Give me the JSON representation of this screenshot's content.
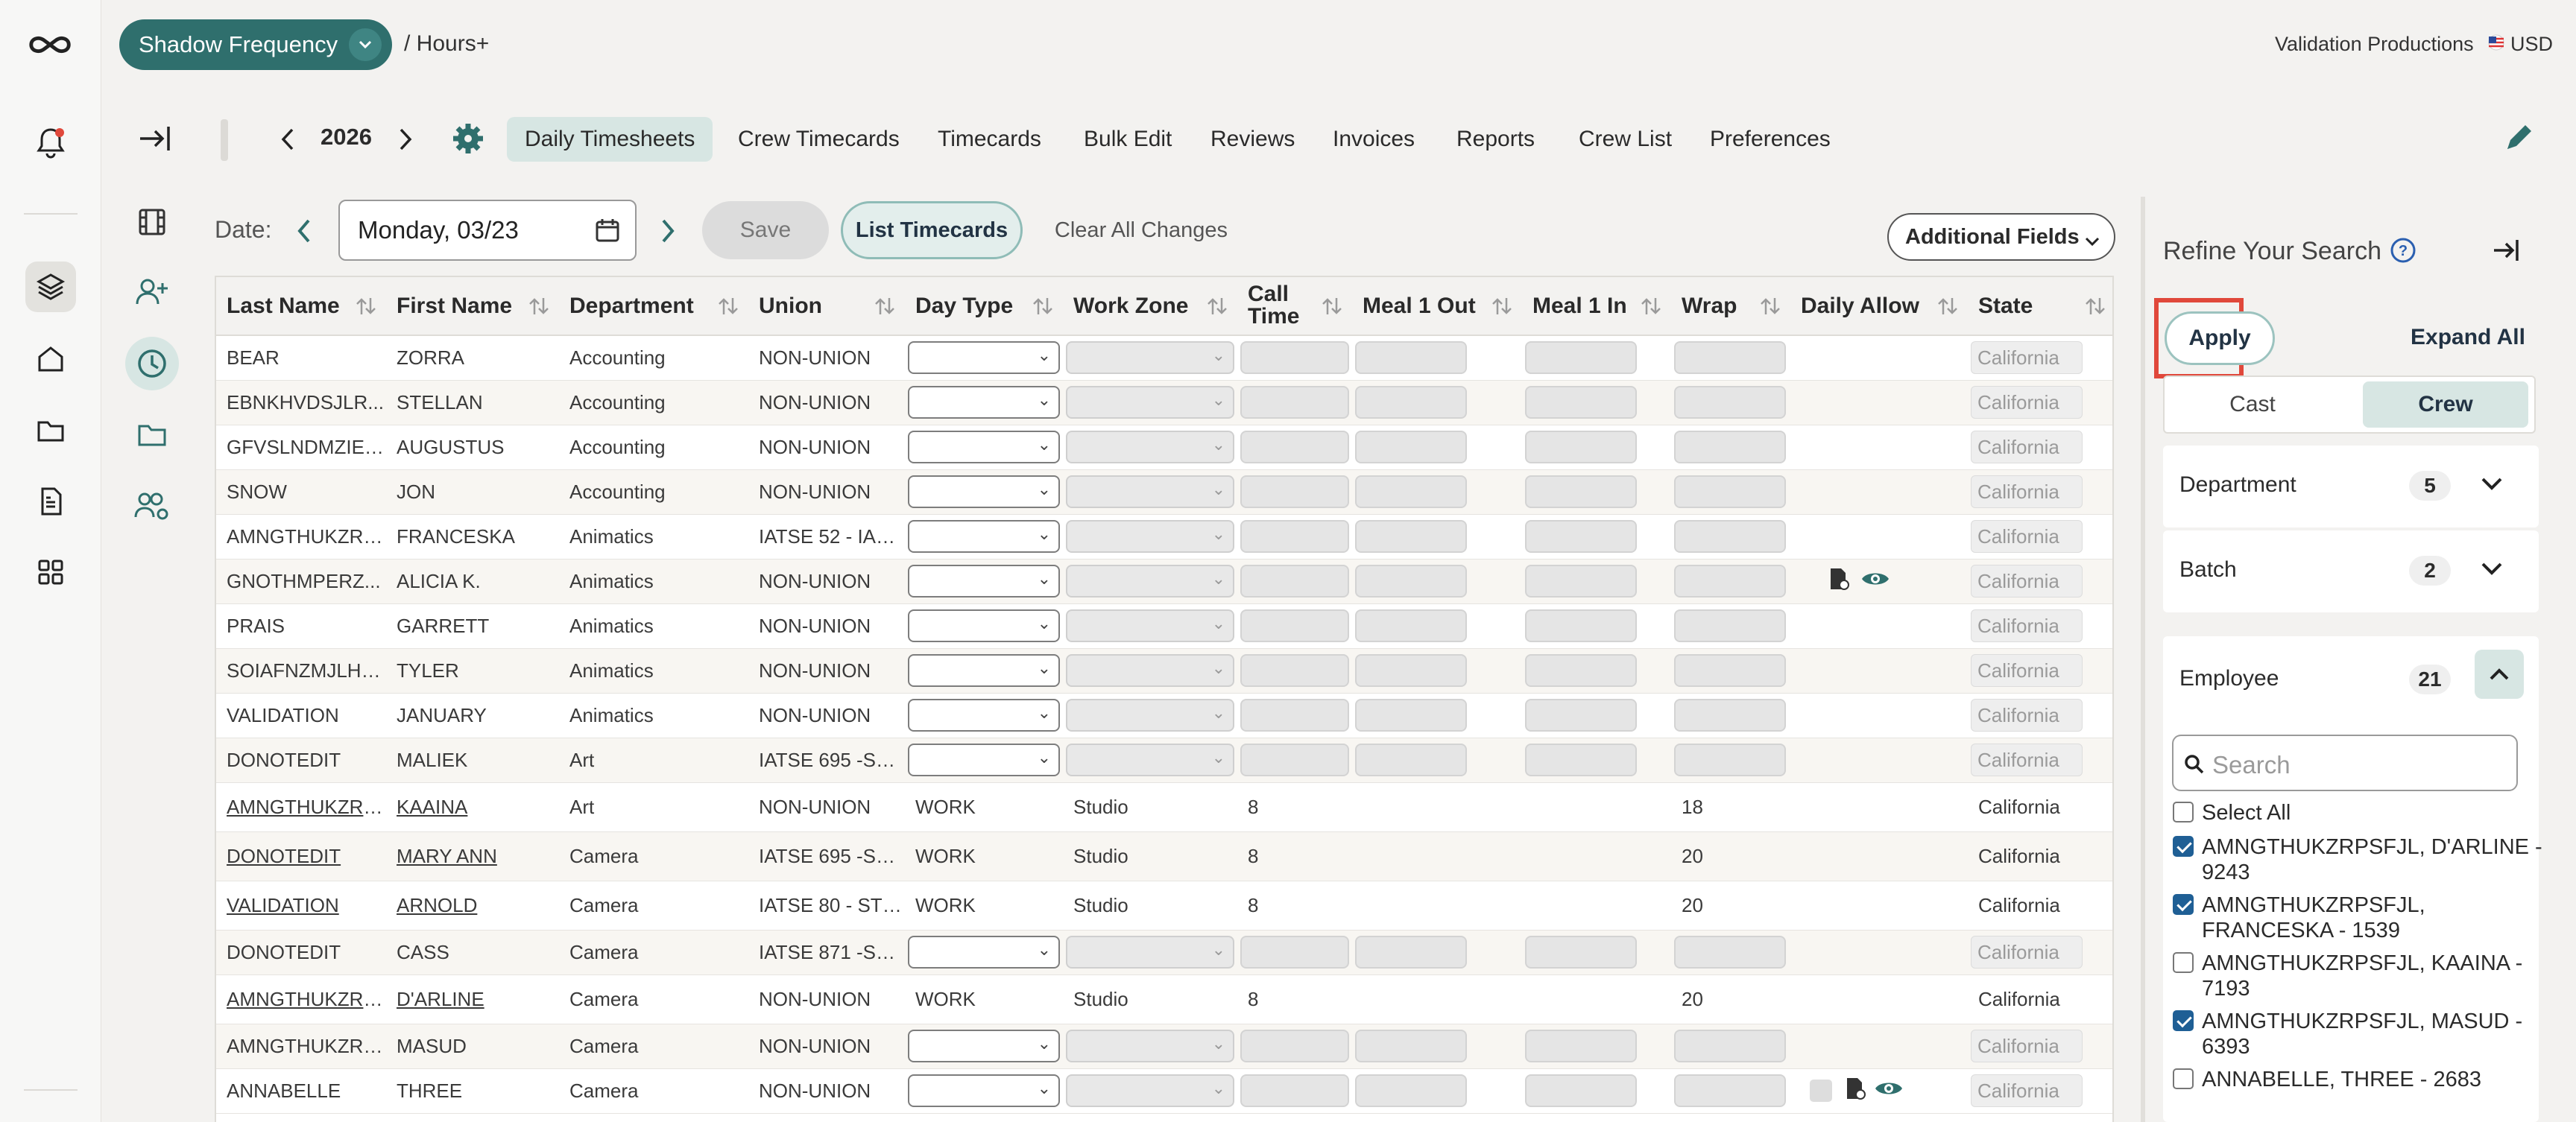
{
  "header": {
    "project_name": "Shadow Frequency",
    "breadcrumb": "/ Hours+",
    "company": "Validation Productions",
    "currency": "USD"
  },
  "nav": {
    "year": "2026",
    "tabs": [
      "Daily Timesheets",
      "Crew Timecards",
      "Timecards",
      "Bulk Edit",
      "Reviews",
      "Invoices",
      "Reports",
      "Crew List",
      "Preferences"
    ],
    "active_tab": "Daily Timesheets"
  },
  "toolbar": {
    "date_label": "Date:",
    "date_value": "Monday, 03/23",
    "save_label": "Save",
    "list_timecards_label": "List Timecards",
    "clear_label": "Clear All Changes",
    "additional_fields_label": "Additional Fields"
  },
  "table": {
    "columns": [
      "Last Name",
      "First Name",
      "Department",
      "Union",
      "Day Type",
      "Work Zone",
      "Call Time",
      "Meal 1 Out",
      "Meal 1 In",
      "Wrap",
      "Daily Allow",
      "State"
    ],
    "rows": [
      {
        "last": "BEAR",
        "first": "ZORRA",
        "dept": "Accounting",
        "union": "NON-UNION",
        "state": "California"
      },
      {
        "last": "EBNKHVDSJLR...",
        "first": "STELLAN",
        "dept": "Accounting",
        "union": "NON-UNION",
        "state": "California"
      },
      {
        "last": "GFVSLNDMZIET...",
        "first": "AUGUSTUS",
        "dept": "Accounting",
        "union": "NON-UNION",
        "state": "California"
      },
      {
        "last": "SNOW",
        "first": "JON",
        "dept": "Accounting",
        "union": "NON-UNION",
        "state": "California"
      },
      {
        "last": "AMNGTHUKZRP...",
        "first": "FRANCESKA",
        "dept": "Animatics",
        "union": "IATSE 52 - IANB...",
        "state": "California"
      },
      {
        "last": "GNOTHMPERZ...",
        "first": "ALICIA K.",
        "dept": "Animatics",
        "union": "NON-UNION",
        "state": "California"
      },
      {
        "last": "PRAIS",
        "first": "GARRETT",
        "dept": "Animatics",
        "union": "NON-UNION",
        "state": "California"
      },
      {
        "last": "SOIAFNZMJLHV...",
        "first": "TYLER",
        "dept": "Animatics",
        "union": "NON-UNION",
        "state": "California"
      },
      {
        "last": "VALIDATION",
        "first": "JANUARY",
        "dept": "Animatics",
        "union": "NON-UNION",
        "state": "California"
      },
      {
        "last": "DONOTEDIT",
        "first": "MALIEK",
        "dept": "Art",
        "union": "IATSE 695 -SOU...",
        "state": "California"
      },
      {
        "last": "AMNGTHUKZRP...",
        "first": "KAAINA",
        "dept": "Art",
        "union": "NON-UNION",
        "day_type": "WORK",
        "work_zone": "Studio",
        "call": "8",
        "wrap": "18",
        "state": "California"
      },
      {
        "last": "DONOTEDIT",
        "first": "MARY ANN",
        "dept": "Camera",
        "union": "IATSE 695 -SOU...",
        "day_type": "WORK",
        "work_zone": "Studio",
        "call": "8",
        "wrap": "20",
        "state": "California"
      },
      {
        "last": "VALIDATION",
        "first": "ARNOLD",
        "dept": "Camera",
        "union": "IATSE 80 - STUD...",
        "day_type": "WORK",
        "work_zone": "Studio",
        "call": "8",
        "wrap": "20",
        "state": "California"
      },
      {
        "last": "DONOTEDIT",
        "first": "CASS",
        "dept": "Camera",
        "union": "IATSE 871 -SCRI...",
        "state": "California"
      },
      {
        "last": "AMNGTHUKZRP...",
        "first": "D'ARLINE",
        "dept": "Camera",
        "union": "NON-UNION",
        "day_type": "WORK",
        "work_zone": "Studio",
        "call": "8",
        "wrap": "20",
        "state": "California"
      },
      {
        "last": "AMNGTHUKZRP...",
        "first": "MASUD",
        "dept": "Camera",
        "union": "NON-UNION",
        "state": "California"
      },
      {
        "last": "ANNABELLE",
        "first": "THREE",
        "dept": "Camera",
        "union": "NON-UNION",
        "state": "California"
      }
    ]
  },
  "refine": {
    "title": "Refine Your Search",
    "apply_label": "Apply",
    "expand_all_label": "Expand All",
    "cast_label": "Cast",
    "crew_label": "Crew",
    "department_label": "Department",
    "department_count": "5",
    "batch_label": "Batch",
    "batch_count": "2",
    "employee_label": "Employee",
    "employee_count": "21",
    "search_placeholder": "Search",
    "select_all_label": "Select All",
    "employees": [
      {
        "name": "AMNGTHUKZRPSFJL, D'ARLINE - 9243",
        "checked": true
      },
      {
        "name": "AMNGTHUKZRPSFJL, FRANCESKA - 1539",
        "checked": true
      },
      {
        "name": "AMNGTHUKZRPSFJL, KAAINA - 7193",
        "checked": false
      },
      {
        "name": "AMNGTHUKZRPSFJL, MASUD - 6393",
        "checked": true
      },
      {
        "name": "ANNABELLE, THREE - 2683",
        "checked": false
      }
    ]
  },
  "colors": {
    "accent": "#2f6f6d",
    "highlight": "#e0483b",
    "active_tab": "#d7e6e3"
  }
}
